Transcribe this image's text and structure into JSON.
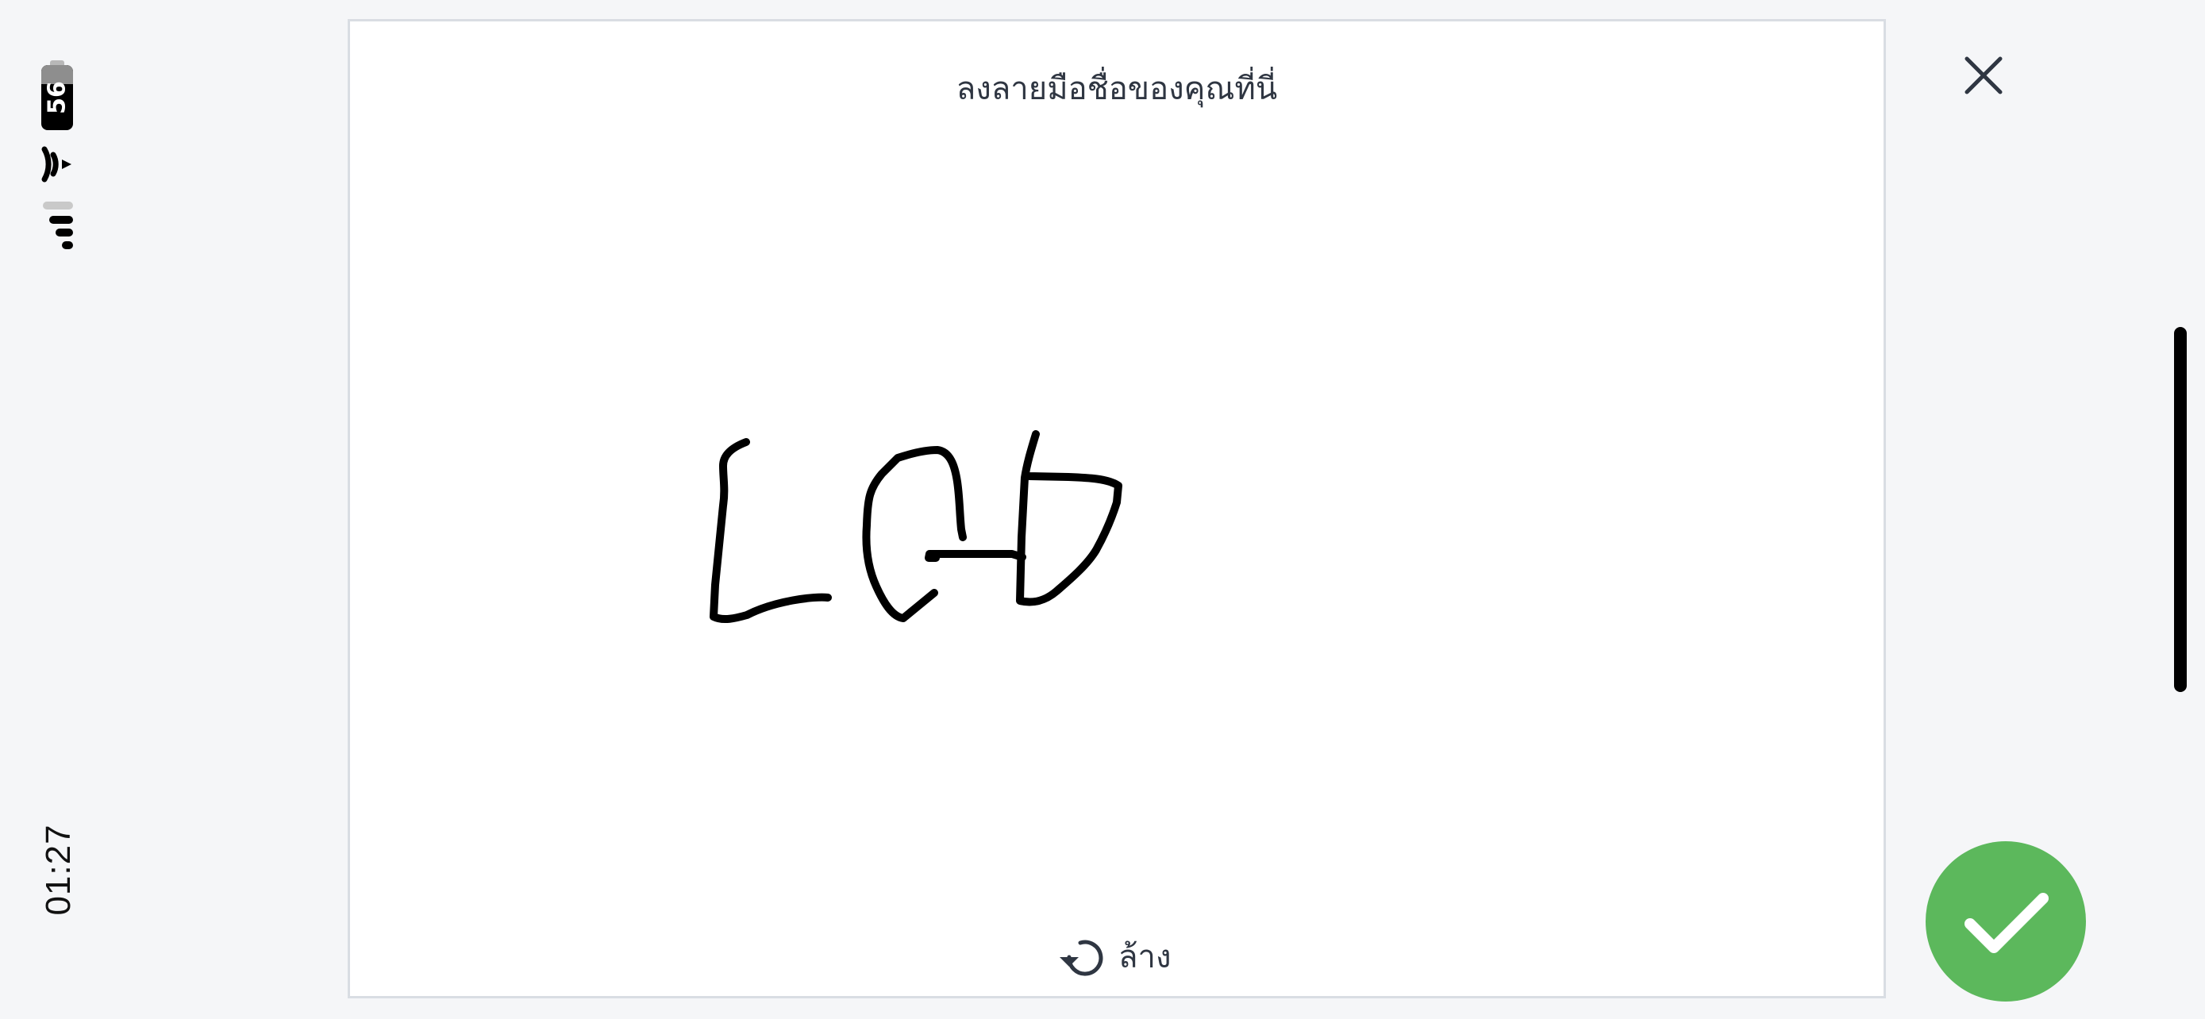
{
  "status_bar": {
    "time": "01:27",
    "battery_percent": "56",
    "battery_icon": "battery-icon",
    "wifi_icon": "wifi-icon",
    "signal_icon": "cellular-signal-icon"
  },
  "signature_panel": {
    "title": "ลงลายมือชื่อของคุณที่นี่",
    "clear_label": "ล้าง",
    "clear_icon": "undo-icon",
    "signature_ink_color": "#000000"
  },
  "toolbar": {
    "close_icon": "close-icon",
    "confirm_icon": "check-icon",
    "confirm_color": "#5cb85c"
  }
}
